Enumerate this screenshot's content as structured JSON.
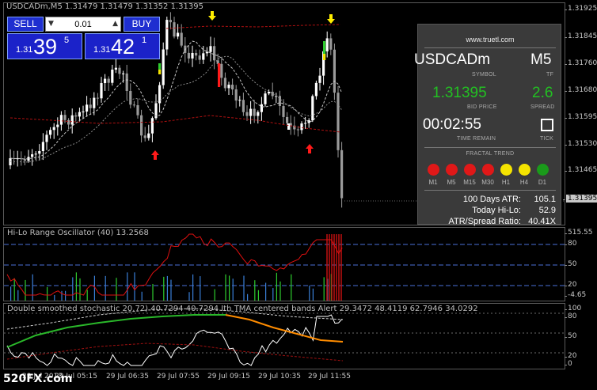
{
  "chart": {
    "caption": "USDCADm,M5  1.31479 1.31479 1.31352 1.31395",
    "price_ticks": [
      "1.31925",
      "1.31845",
      "1.31760",
      "1.31680",
      "1.31595",
      "1.31530",
      "1.31465",
      "1.31395"
    ],
    "current_price": "1.31395"
  },
  "trade_panel": {
    "sell_label": "SELL",
    "buy_label": "BUY",
    "lot_value": "0.01",
    "spin_down": "▼",
    "spin_up": "▲",
    "bid_prefix": "1.31",
    "bid_big": "39",
    "bid_sup": "5",
    "ask_prefix": "1.31",
    "ask_big": "42",
    "ask_sup": "1"
  },
  "info_panel": {
    "site": "www.truetl.com",
    "symbol": "USDCADm",
    "symbol_label": "SYMBOL",
    "timeframe": "M5",
    "timeframe_label": "TF",
    "bid_price": "1.31395",
    "bid_price_label": "BID PRICE",
    "spread": "2.6",
    "spread_label": "SPREAD",
    "time_remain": "00:02:55",
    "time_remain_label": "TIME REMAIN",
    "tick_label": "TICK",
    "fractal_title": "FRACTAL TREND",
    "fractal": [
      {
        "tf": "M1",
        "color": "#e01818"
      },
      {
        "tf": "M5",
        "color": "#e01818"
      },
      {
        "tf": "M15",
        "color": "#e01818"
      },
      {
        "tf": "M30",
        "color": "#e01818"
      },
      {
        "tf": "H1",
        "color": "#f5e400"
      },
      {
        "tf": "H4",
        "color": "#f5e400"
      },
      {
        "tf": "D1",
        "color": "#1a9a1a"
      }
    ],
    "atr_label": "100 Days ATR:",
    "atr_value": "105.1",
    "hilo_label": "Today Hi-Lo:",
    "hilo_value": "52.9",
    "ratio_label": "ATR/Spread Ratio:",
    "ratio_value": "40.41X"
  },
  "oscillator": {
    "caption": "Hi-Lo Range Oscillator (40) 13.2568",
    "ticks": [
      "515.55",
      "80",
      "50",
      "20",
      "-4.65"
    ]
  },
  "stochastic": {
    "caption": "Double smoothed stochastic 20.72) 40.7294 40.7294  Ith TMA centered bands Alert 29.3472 48.4119 62.7946 34.0292",
    "ticks": [
      "100",
      "80",
      "50",
      "20",
      "0"
    ]
  },
  "time_axis": [
    "29 Jul 2013",
    "29 Jul 05:15",
    "29 Jul 06:35",
    "29 Jul 07:55",
    "29 Jul 09:15",
    "29 Jul 10:35",
    "29 Jul 11:55"
  ],
  "watermark": "520FX.com",
  "colors": {
    "bull_candle": "#ffffff",
    "bear_candle": "#9a9a9a",
    "band": "#b01010",
    "ma": "#c8c8c8",
    "up_arrow": "#ff1a1a",
    "down_arrow": "#ffee00",
    "osc_line": "#e01010",
    "osc_level": "#4a6fd8",
    "stoch_white": "#ffffff",
    "stoch_green": "#2ab82a",
    "stoch_orange": "#ff8c00"
  }
}
